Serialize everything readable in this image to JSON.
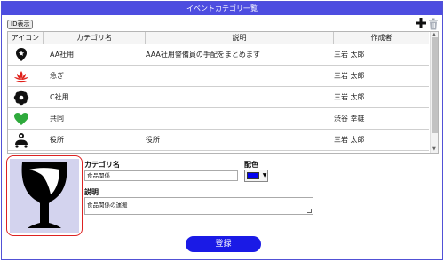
{
  "window": {
    "title": "イベントカテゴリ一覧"
  },
  "toolbar": {
    "id_toggle_label": "ID表示",
    "add_icon": "plus-icon",
    "delete_icon": "trash-icon"
  },
  "table": {
    "columns": [
      "アイコン",
      "カテゴリ名",
      "説明",
      "作成者"
    ],
    "rows": [
      {
        "icon": "map-pin-icon",
        "name": "AA社用",
        "description": "AAA社用警備員の手配をまとめます",
        "author": "三岩 太郎"
      },
      {
        "icon": "lotus-icon",
        "name": "急ぎ",
        "description": "",
        "author": "三岩 太郎"
      },
      {
        "icon": "flower-icon",
        "name": "C社用",
        "description": "",
        "author": "三岩 太郎"
      },
      {
        "icon": "heart-icon",
        "name": "共同",
        "description": "",
        "author": "渋谷 幸雄"
      },
      {
        "icon": "people-icon",
        "name": "役所",
        "description": "役所",
        "author": "三岩 太郎"
      }
    ],
    "colors": {
      "lotus": "#e0201a",
      "heart": "#2eaa3c"
    }
  },
  "form": {
    "preview_icon": "wine-glass-icon",
    "name_label": "カテゴリ名",
    "name_value": "食品関係",
    "color_label": "配色",
    "color_value": "#0000ee",
    "desc_label": "説明",
    "desc_value": "食品関係の運搬",
    "submit_label": "登録"
  }
}
